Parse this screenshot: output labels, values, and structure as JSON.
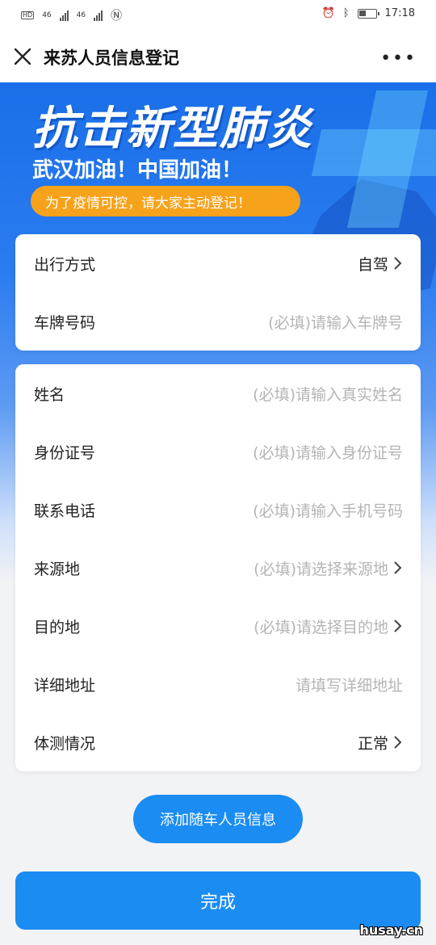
{
  "status_bar": {
    "network_left": "46",
    "network_right": "46",
    "time": "17:18"
  },
  "title_bar": {
    "title": "来苏人员信息登记",
    "more": "•••"
  },
  "hero": {
    "headline": "抗击新型肺炎",
    "subtitle": "武汉加油！中国加油！",
    "notice": "为了疫情可控，请大家主动登记！"
  },
  "form_travel": {
    "rows": [
      {
        "label": "出行方式",
        "value": "自驾",
        "placeholder": ""
      },
      {
        "label": "车牌号码",
        "value": "",
        "placeholder": "(必填)请输入车牌号"
      }
    ]
  },
  "form_person": {
    "rows": [
      {
        "label": "姓名",
        "placeholder": "(必填)请输入真实姓名"
      },
      {
        "label": "身份证号",
        "placeholder": "(必填)请输入身份证号"
      },
      {
        "label": "联系电话",
        "placeholder": "(必填)请输入手机号码"
      },
      {
        "label": "来源地",
        "placeholder": "(必填)请选择来源地"
      },
      {
        "label": "目的地",
        "placeholder": "(必填)请选择目的地"
      },
      {
        "label": "详细地址",
        "placeholder": "请填写详细地址"
      },
      {
        "label": "体测情况",
        "value": "正常"
      }
    ]
  },
  "buttons": {
    "add_companion": "添加随车人员信息",
    "done": "完成"
  },
  "watermark": "husay.cn",
  "icons": {
    "close": "close-icon",
    "more": "more-icon",
    "chevron": "chevron-right-icon"
  },
  "colors": {
    "primary": "#1b8cf2",
    "hero_blue": "#1a6fe8",
    "notice_orange": "#f7a21b",
    "placeholder": "#b4b4b4"
  }
}
